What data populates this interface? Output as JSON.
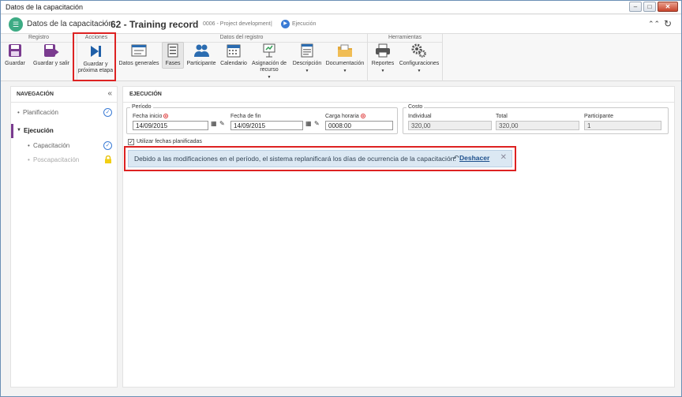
{
  "window": {
    "title": "Datos de la capacitación",
    "buttons": {
      "minimize": "–",
      "maximize": "□",
      "close": "✕"
    }
  },
  "header": {
    "app_icon": "training-icon",
    "title": "Datos de la capacitación",
    "separator": "›",
    "record": "62 - Training record",
    "divider": "|",
    "project": "0006 - Project development",
    "stage": "Ejecución",
    "collapse": "⌃⌃",
    "refresh": "↻"
  },
  "ribbon": {
    "groups": {
      "registro": "Registro",
      "acciones": "Acciones",
      "datos": "Datos del registro",
      "herramientas": "Herramientas"
    },
    "buttons": {
      "guardar": "Guardar",
      "guardar_salir": "Guardar y salir",
      "guardar_etapa": "Guardar y próxima etapa",
      "datos_generales": "Datos generales",
      "fases": "Fases",
      "participante": "Participante",
      "calendario": "Calendario",
      "asignacion": "Asignación de recurso",
      "descripcion": "Descripción",
      "documentacion": "Documentación",
      "reportes": "Reportes",
      "configuraciones": "Configuraciones"
    },
    "active": "Fases"
  },
  "nav": {
    "title": "NAVEGACIÓN",
    "collapse": "«",
    "items": [
      {
        "label": "Planificación",
        "status": "done"
      },
      {
        "label": "Ejecución",
        "status": "current"
      },
      {
        "label": "Capacitación",
        "status": "done"
      },
      {
        "label": "Poscapacitación",
        "status": "locked"
      }
    ]
  },
  "main": {
    "title": "EJECUCIÓN",
    "periodo": {
      "legend": "Período",
      "fecha_inicio_label": "Fecha inicio",
      "fecha_inicio": "14/09/2015",
      "fecha_fin_label": "Fecha de fin",
      "fecha_fin": "14/09/2015",
      "carga_label": "Carga horaria",
      "carga": "0008:00"
    },
    "costo": {
      "legend": "Costo",
      "individual_label": "Individual",
      "individual": "320,00",
      "total_label": "Total",
      "total": "320,00",
      "participante_label": "Participante",
      "participante": "1"
    },
    "checkbox_label": "Utilizar fechas planificadas",
    "checkbox_checked": true,
    "alert": {
      "message": "Debido a las modificaciones en el período, el sistema replanificará los días de ocurrencia de la capacitación.",
      "undo": "Deshacer",
      "close": "✕"
    }
  },
  "colors": {
    "accent": "#3a7bd5",
    "highlight": "#d22222",
    "app": "#3dab84"
  }
}
